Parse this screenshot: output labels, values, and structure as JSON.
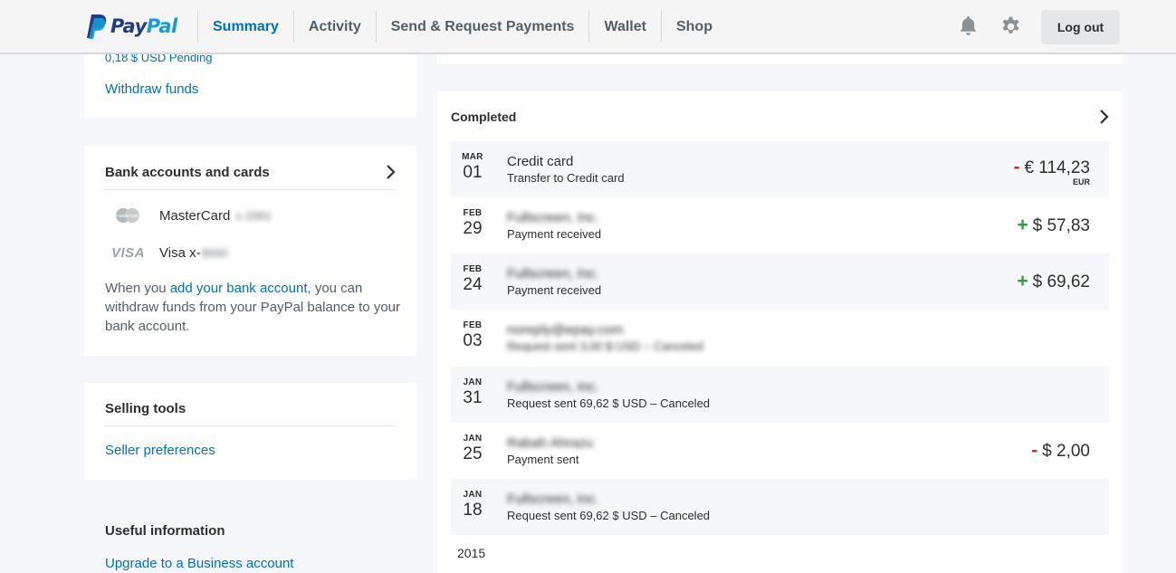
{
  "header": {
    "brand_part1": "Pay",
    "brand_part2": "Pal",
    "nav": [
      "Summary",
      "Activity",
      "Send & Request Payments",
      "Wallet",
      "Shop"
    ],
    "logout_label": "Log out"
  },
  "left": {
    "balance_pending": "0,18 $ USD Pending",
    "withdraw_link": "Withdraw funds",
    "bank": {
      "title": "Bank accounts and cards",
      "cards": [
        {
          "brand": "MasterCard",
          "logo_text": "mastercard",
          "label": "MasterCard",
          "masked": "x-2981"
        },
        {
          "brand": "Visa",
          "logo_text": "VISA",
          "label": "Visa x-",
          "masked": "8690"
        }
      ],
      "info_before": "When you ",
      "info_link": "add your bank account",
      "info_after": ", you can withdraw funds from your PayPal balance to your bank account."
    },
    "selling": {
      "title": "Selling tools",
      "link": "Seller preferences"
    },
    "useful": {
      "title": "Useful information",
      "link": "Upgrade to a Business account"
    }
  },
  "activity": {
    "section_title": "Completed",
    "transactions": [
      {
        "month": "MAR",
        "day": "01",
        "name": "Credit card",
        "desc": "Transfer to Credit card",
        "sign": "-",
        "amount": "€ 114,23",
        "currency": "EUR"
      },
      {
        "month": "FEB",
        "day": "29",
        "name": "Fullscreen, Inc.",
        "desc": "Payment received",
        "sign": "+",
        "amount": "$ 57,83",
        "currency": ""
      },
      {
        "month": "FEB",
        "day": "24",
        "name": "Fullscreen, Inc.",
        "desc": "Payment received",
        "sign": "+",
        "amount": "$ 69,62",
        "currency": ""
      },
      {
        "month": "FEB",
        "day": "03",
        "name": "noreply@epay.com",
        "desc": "Request sent 3,00 $ USD – Canceled",
        "sign": "",
        "amount": "",
        "currency": ""
      },
      {
        "month": "JAN",
        "day": "31",
        "name": "Fullscreen, Inc.",
        "desc": "Request sent 69,62 $ USD – Canceled",
        "sign": "",
        "amount": "",
        "currency": ""
      },
      {
        "month": "JAN",
        "day": "25",
        "name": "Rabah Ahrazu",
        "desc": "Payment sent",
        "sign": "-",
        "amount": "$ 2,00",
        "currency": ""
      },
      {
        "month": "JAN",
        "day": "18",
        "name": "Fullscreen, Inc.",
        "desc": "Request sent 69,62 $ USD – Canceled",
        "sign": "",
        "amount": "",
        "currency": ""
      }
    ],
    "year_label": "2015"
  },
  "colors": {
    "brand_blue": "#0070ba",
    "negative": "#c72e2e",
    "positive": "#2e9e3e"
  }
}
